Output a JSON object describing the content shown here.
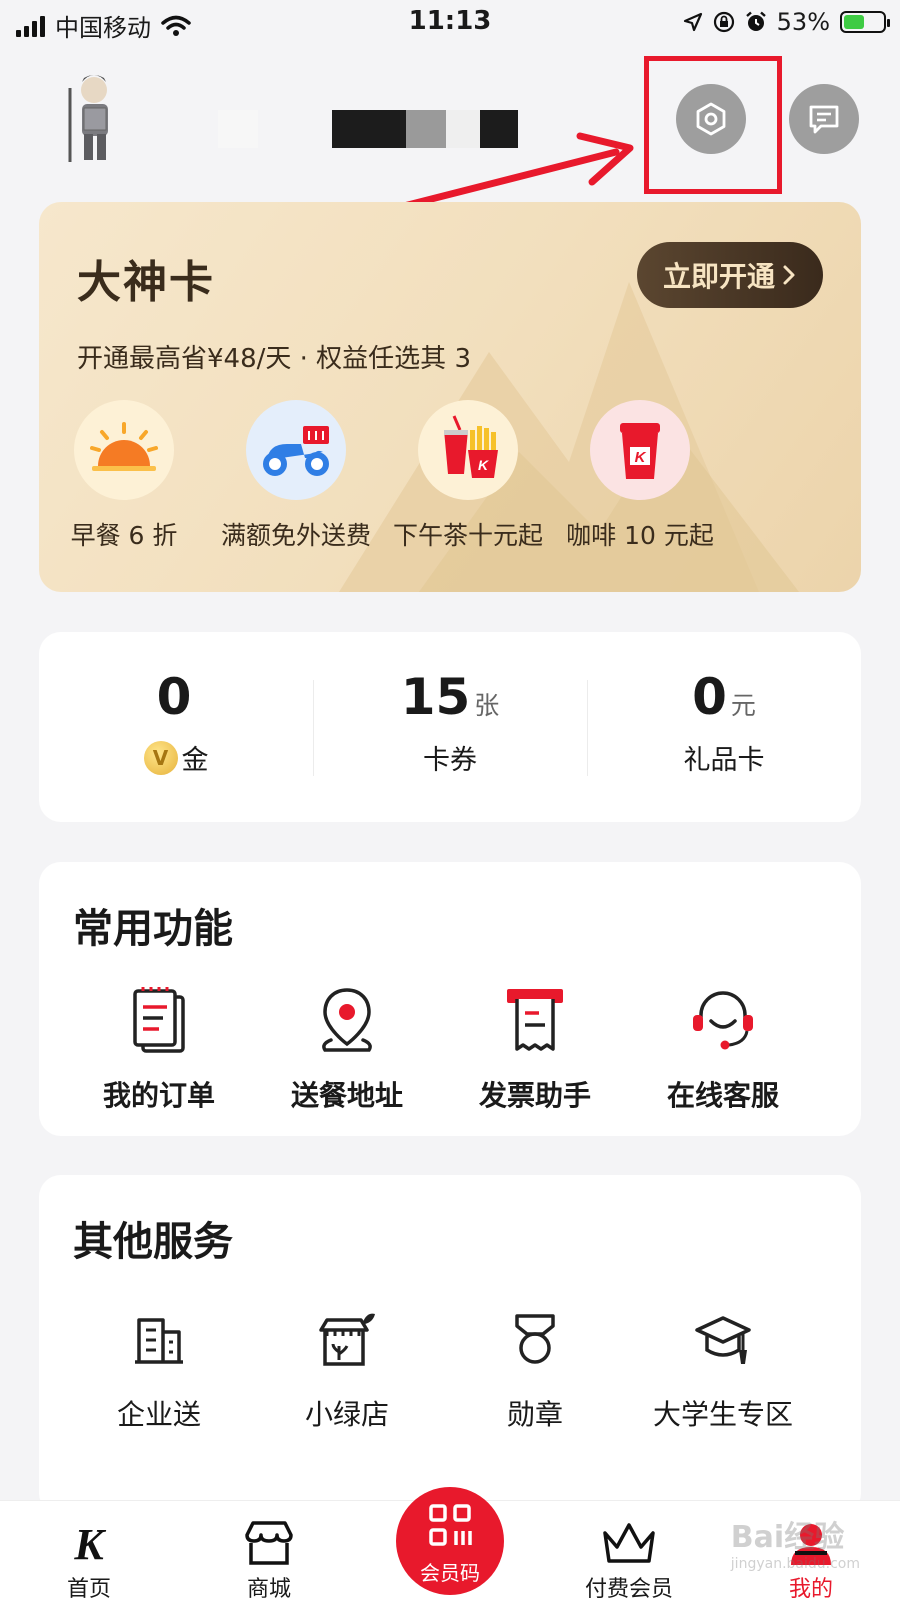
{
  "status_bar": {
    "carrier": "中国移动",
    "time": "11:13",
    "battery_percent": "53%",
    "battery_level": 0.53
  },
  "header": {
    "settings_icon": "hexagon-settings-icon",
    "message_icon": "message-icon"
  },
  "vip_card": {
    "title": "大神卡",
    "button_label": "立即开通",
    "subtitle": "开通最高省¥48/天 · 权益任选其 3",
    "benefits": [
      {
        "label": "早餐 6 折",
        "icon": "sunrise-icon"
      },
      {
        "label": "满额免外送费",
        "icon": "delivery-scooter-icon"
      },
      {
        "label": "下午茶十元起",
        "icon": "drink-fries-icon"
      },
      {
        "label": "咖啡 10 元起",
        "icon": "coffee-cup-icon"
      }
    ]
  },
  "assets": [
    {
      "value": "0",
      "unit": "",
      "label": "金"
    },
    {
      "value": "15",
      "unit": "张",
      "label": "卡券"
    },
    {
      "value": "0",
      "unit": "元",
      "label": "礼品卡"
    }
  ],
  "common_functions": {
    "title": "常用功能",
    "items": [
      {
        "label": "我的订单",
        "icon": "order-list-icon"
      },
      {
        "label": "送餐地址",
        "icon": "location-pin-icon"
      },
      {
        "label": "发票助手",
        "icon": "invoice-icon"
      },
      {
        "label": "在线客服",
        "icon": "headset-icon"
      }
    ]
  },
  "other_services": {
    "title": "其他服务",
    "items": [
      {
        "label": "企业送",
        "icon": "building-icon"
      },
      {
        "label": "小绿店",
        "icon": "green-store-icon"
      },
      {
        "label": "勋章",
        "icon": "medal-icon"
      },
      {
        "label": "大学生专区",
        "icon": "graduation-cap-icon"
      }
    ]
  },
  "bottom_nav": {
    "items": [
      {
        "label": "首页",
        "icon": "kfc-k-logo-icon"
      },
      {
        "label": "商城",
        "icon": "store-icon"
      },
      {
        "label": "会员码",
        "icon": "qr-code-icon"
      },
      {
        "label": "付费会员",
        "icon": "crown-icon"
      },
      {
        "label": "我的",
        "icon": "profile-icon"
      }
    ],
    "active_index": 4
  },
  "watermark": {
    "text": "Bai经验",
    "sub": "jingyan.baidu.com"
  },
  "colors": {
    "brand_red": "#e8192c",
    "vip_gold": "#f2dfbd",
    "vip_dark": "#3a2c1c"
  }
}
